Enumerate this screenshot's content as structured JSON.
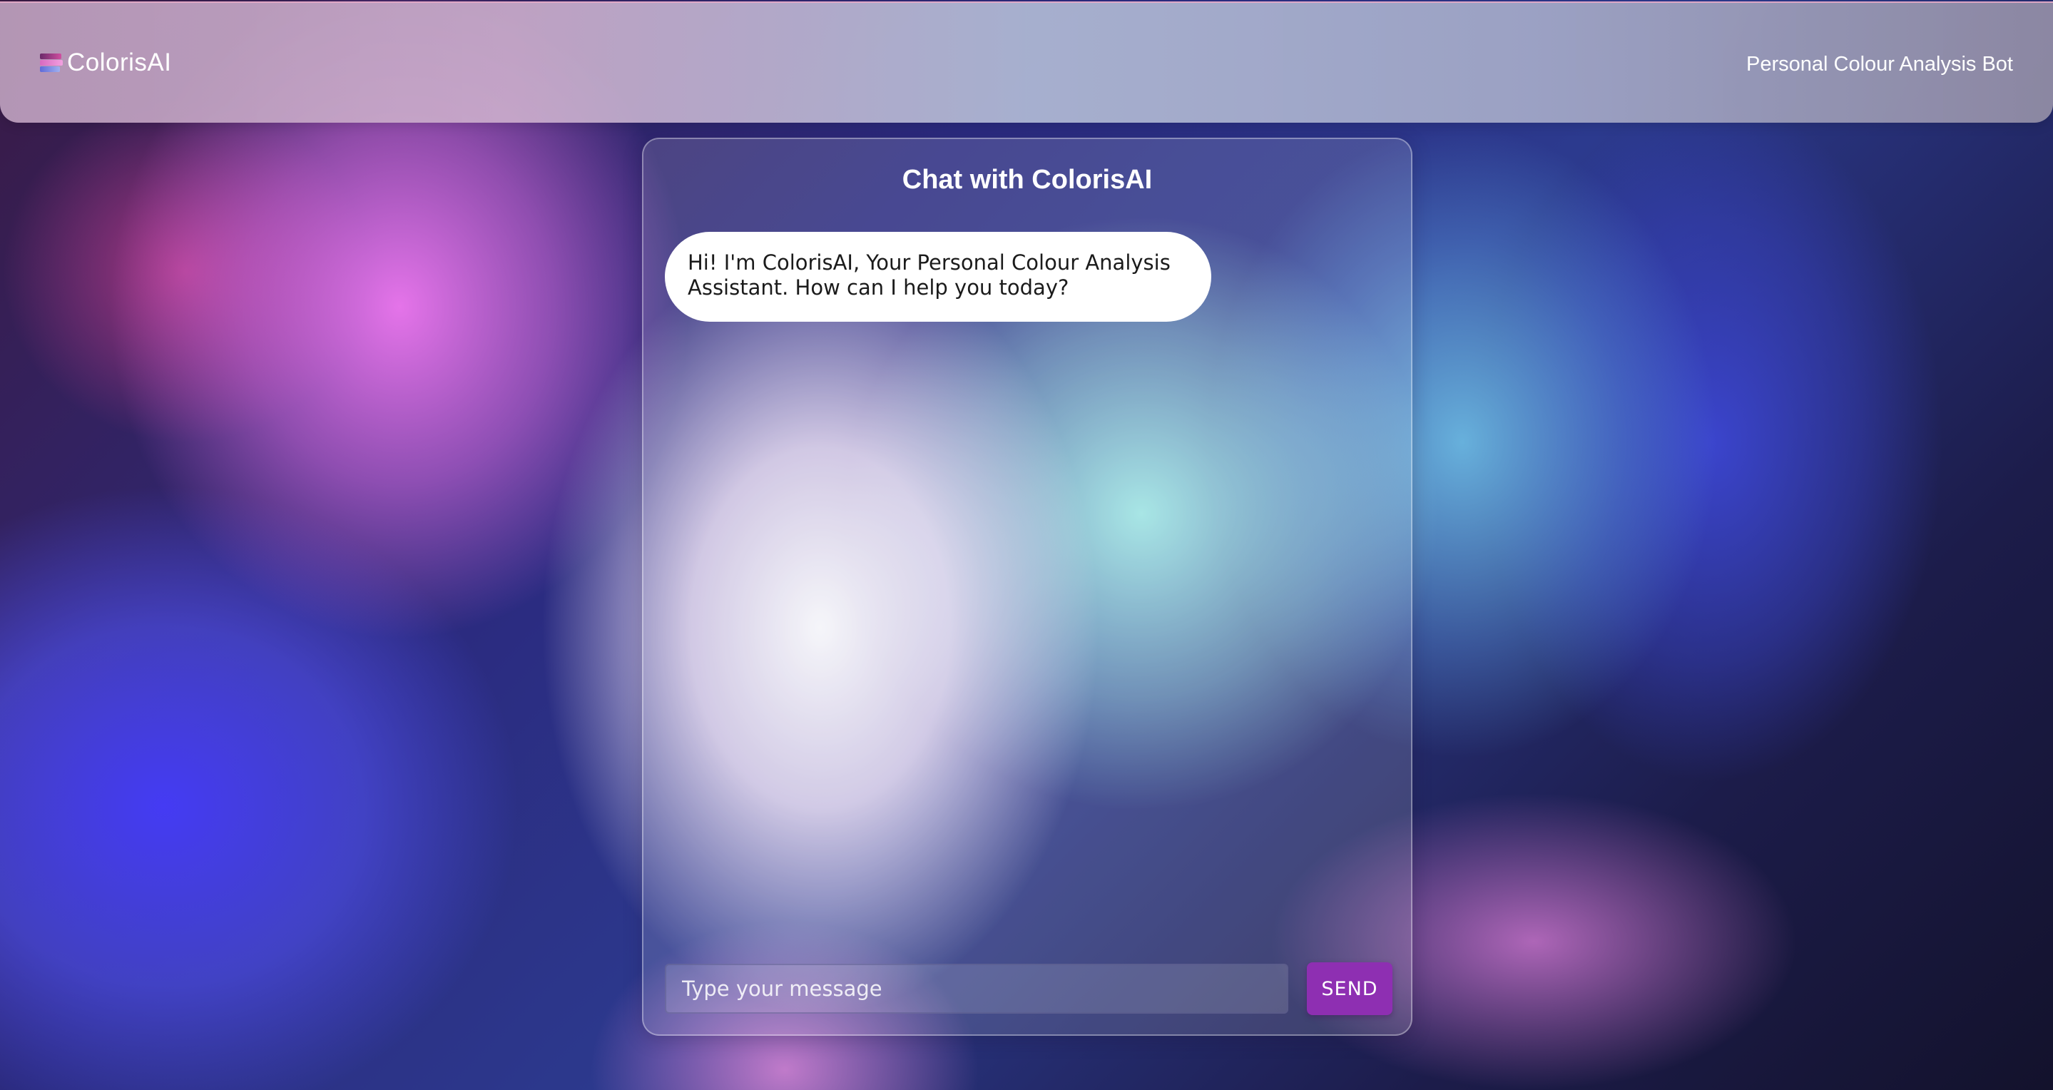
{
  "header": {
    "brand_name": "ColorisAI",
    "tagline": "Personal Colour Analysis Bot",
    "logo_icon": "colour-stripes-icon"
  },
  "chat": {
    "title": "Chat with ColorisAI",
    "messages": [
      {
        "sender": "bot",
        "text": "Hi! I'm ColorisAI, Your Personal Colour Analysis Assistant. How can I help you today?"
      }
    ],
    "input": {
      "placeholder": "Type your message",
      "value": ""
    },
    "send_label": "SEND"
  },
  "colors": {
    "send_button": "#8e2fb2",
    "bubble_bg": "#ffffff",
    "text_light": "#ffffff"
  }
}
